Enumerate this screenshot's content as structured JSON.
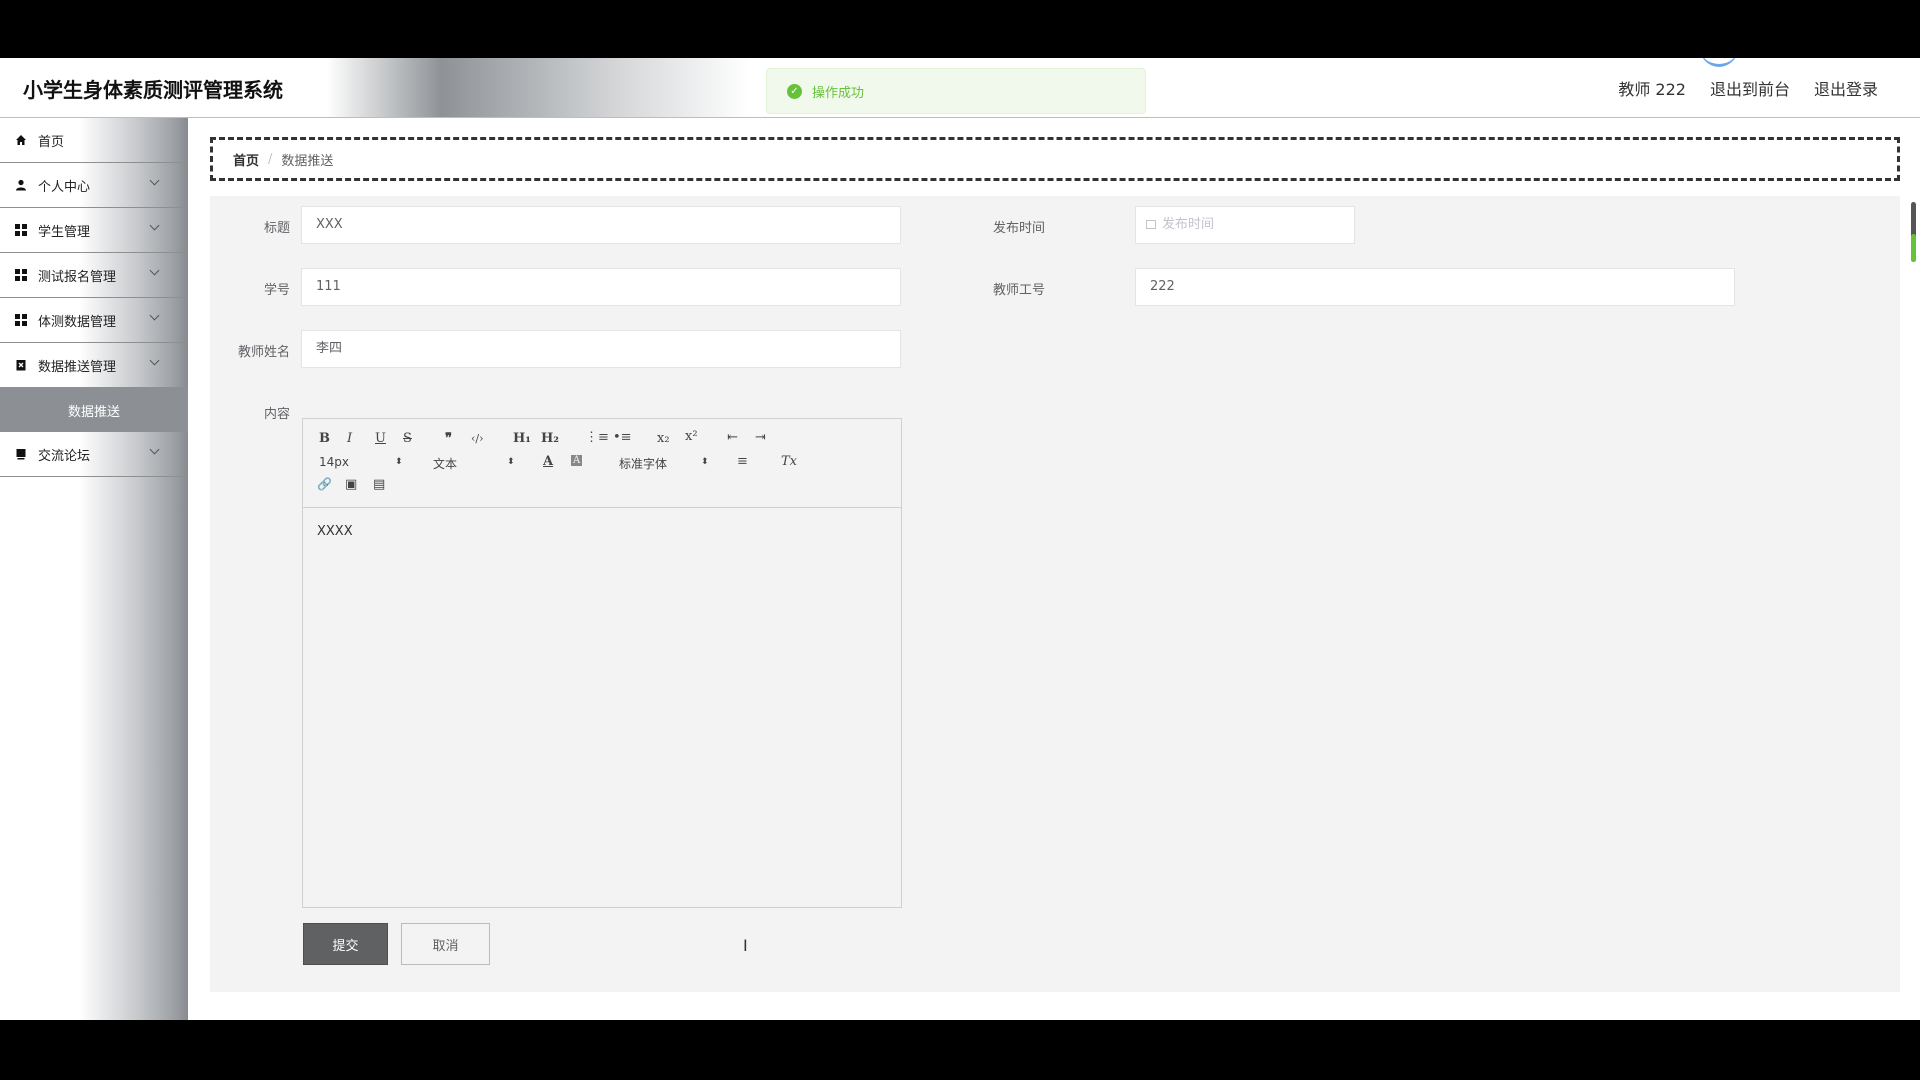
{
  "header": {
    "title": "小学生身体素质测评管理系统",
    "user": "教师 222",
    "to_front": "退出到前台",
    "logout": "退出登录"
  },
  "toast": {
    "text": "操作成功",
    "color": "#67c23a"
  },
  "sidebar": {
    "items": [
      {
        "label": "首页",
        "icon": "home-icon"
      },
      {
        "label": "个人中心",
        "icon": "user-icon"
      },
      {
        "label": "学生管理",
        "icon": "grid-icon"
      },
      {
        "label": "测试报名管理",
        "icon": "grid-icon"
      },
      {
        "label": "体测数据管理",
        "icon": "grid-icon"
      },
      {
        "label": "数据推送管理",
        "icon": "clipboard-icon"
      },
      {
        "label": "交流论坛",
        "icon": "forum-icon"
      }
    ],
    "active_sub": "数据推送"
  },
  "breadcrumb": {
    "home": "首页",
    "sep": "/",
    "current": "数据推送"
  },
  "form": {
    "title_label": "标题",
    "title_value": "XXX",
    "publish_time_label": "发布时间",
    "publish_time_placeholder": "发布时间",
    "student_no_label": "学号",
    "student_no_value": "111",
    "teacher_no_label": "教师工号",
    "teacher_no_value": "222",
    "teacher_name_label": "教师姓名",
    "teacher_name_value": "李四",
    "content_label": "内容",
    "content_value": "XXXX",
    "submit": "提交",
    "cancel": "取消"
  },
  "editor": {
    "font_size": "14px",
    "header_picker": "文本",
    "font_family": "标准字体",
    "buttons": {
      "bold": "B",
      "italic": "I",
      "underline": "U",
      "strike": "S",
      "quote": "❞",
      "code": "‹/›",
      "h1": "H₁",
      "h2": "H₂",
      "ordered": "⋮≡",
      "bullet": "•≡",
      "sub": "x₂",
      "sup": "x²",
      "outdent": "⇤",
      "indent": "⇥",
      "color": "A",
      "background": "A",
      "align": "≡",
      "clean": "Tx",
      "link": "🔗",
      "image": "▣",
      "video": "▤"
    }
  },
  "colors": {
    "accent": "#5f6163",
    "success": "#67c23a"
  }
}
